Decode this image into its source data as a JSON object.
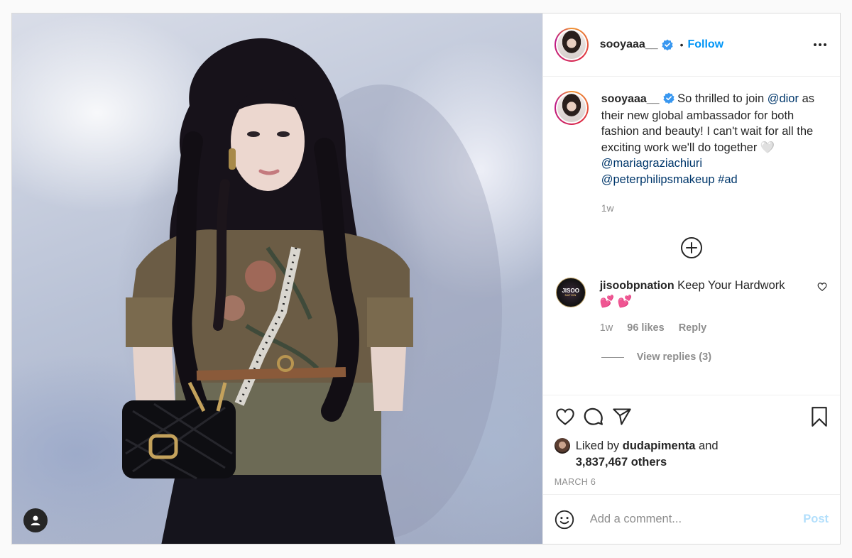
{
  "post": {
    "username": "sooyaaa__",
    "follow_label": "Follow",
    "separator": "•",
    "caption": {
      "text_before": " So thrilled to join ",
      "mention_1": "@dior",
      "text_after": " as their new global ambassador for both fashion and beauty! I can't wait for all the exciting work we'll do together ",
      "emoji": "🤍",
      "mention_2": "@mariagraziachiuri",
      "mention_3": "@peterphilipsmakeup",
      "hashtag": "#ad",
      "time": "1w"
    },
    "comment": {
      "username": "jisoobpnation",
      "avatar_text": "JISOO",
      "avatar_subtext": "NATION",
      "text": " Keep Your Hardwork",
      "emoji": "💕 💕",
      "time": "1w",
      "likes": "96 likes",
      "reply_label": "Reply",
      "view_replies": "View replies (3)"
    },
    "liked_by": {
      "prefix": "Liked by ",
      "user": "dudapimenta",
      "middle": " and",
      "others": "3,837,467 others"
    },
    "date": "MARCH 6",
    "comment_input": {
      "placeholder": "Add a comment..."
    },
    "post_button": "Post"
  },
  "icons": {
    "more": "more-options-icon",
    "verified": "verified-badge-icon",
    "load_more": "plus-circle-icon",
    "like": "heart-icon",
    "comment": "comment-icon",
    "share": "paper-plane-icon",
    "save": "bookmark-icon",
    "emoji": "smiley-icon",
    "user_tag": "person-icon"
  },
  "colors": {
    "accent": "#0095f6",
    "mention": "#00376b",
    "muted": "#8e8e8e",
    "text": "#262626",
    "post_disabled": "#b2dffc"
  }
}
